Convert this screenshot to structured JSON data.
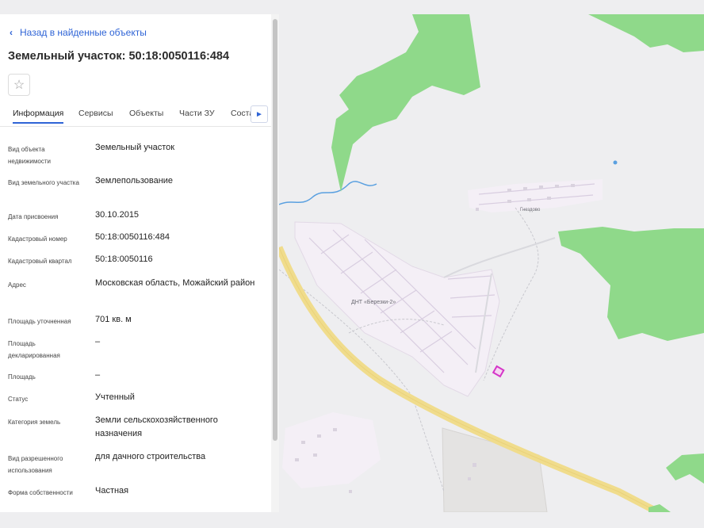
{
  "panel": {
    "back_label": "Назад в найденные объекты",
    "title": "Земельный участок: 50:18:0050116:484",
    "favorite_icon": "star-icon",
    "tabs": [
      "Информация",
      "Сервисы",
      "Объекты",
      "Части ЗУ",
      "Соста"
    ],
    "tab_more_icon": "chevron-right-icon",
    "active_tab": "Информация",
    "fields": [
      {
        "label": "Вид объекта недвижимости",
        "value": "Земельный участок"
      },
      {
        "label": "Вид земельного участка",
        "value": "Землепользование"
      },
      {
        "label": "Дата присвоения",
        "value": "30.10.2015"
      },
      {
        "label": "Кадастровый номер",
        "value": "50:18:0050116:484"
      },
      {
        "label": "Кадастровый квартал",
        "value": "50:18:0050116"
      },
      {
        "label": "Адрес",
        "value": "Московская область, Можайский район"
      },
      {
        "label": "Площадь уточненная",
        "value": "701 кв. м"
      },
      {
        "label": "Площадь декларированная",
        "value": "–"
      },
      {
        "label": "Площадь",
        "value": "–"
      },
      {
        "label": "Статус",
        "value": "Учтенный"
      },
      {
        "label": "Категория земель",
        "value": "Земли сельскохозяйственного назначения"
      },
      {
        "label": "Вид разрешенного использования",
        "value": "для дачного строительства"
      },
      {
        "label": "Форма собственности",
        "value": "Частная"
      }
    ]
  },
  "map": {
    "settlement_label": "ДНТ «Березки-2»",
    "village_label": "Гнездово",
    "colors": {
      "forest": "#8fd98a",
      "road": "#f0dc8c",
      "settlement": "#f4eff6",
      "parcel": "#d535c8",
      "river": "#5aa0e0",
      "background": "#eeeef0"
    }
  }
}
